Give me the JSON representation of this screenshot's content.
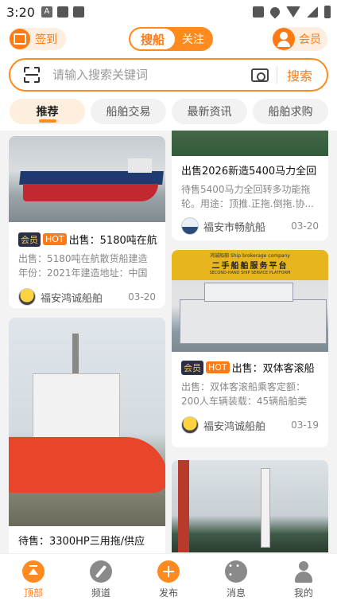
{
  "status_bar": {
    "time": "3:20",
    "a_icon": "A"
  },
  "header": {
    "checkin_label": "签到",
    "segment": {
      "active": "搜船",
      "inactive": "关注"
    },
    "member_label": "会员"
  },
  "search": {
    "placeholder": "请输入搜索关键词",
    "button": "搜索"
  },
  "tabs": [
    {
      "label": "推荐",
      "active": true
    },
    {
      "label": "船舶交易"
    },
    {
      "label": "最新资讯"
    },
    {
      "label": "船舶求购"
    }
  ],
  "cards": {
    "left1": {
      "vip_badge": "会员",
      "hot_badge": "HOT",
      "title": "出售：5180吨在航",
      "desc": "出售：5180吨在航散货船建造年份：2021年建造地址：中国 ...",
      "author": "福安鸿诚船舶",
      "date": "03-20"
    },
    "left2": {
      "title": "待售：3300HP三用拖/供应"
    },
    "right1": {
      "title": "出售2026新造5400马力全回",
      "desc": "待售5400马力全回转多功能拖轮。用途：顶推.正拖.倒拖.协...",
      "author": "福安市畅航船",
      "date": "03-20"
    },
    "right2": {
      "banner_small": "鸿诚船舶  Ship brokerage company",
      "banner_main": "二手船舶服务平台",
      "banner_sub": "SECOND-HAND SHIP SERVICE PLATFORM",
      "vip_badge": "会员",
      "hot_badge": "HOT",
      "title": "出售：双体客滚船",
      "desc": "出售：双体客滚船乘客定额：200人车辆装载：45辆船舶类型...",
      "author": "福安鸿诚船舶",
      "date": "03-19"
    }
  },
  "tabbar": [
    {
      "label": "顶部",
      "icon": "top-arrow-icon",
      "active": true
    },
    {
      "label": "频道",
      "icon": "compass-icon"
    },
    {
      "label": "发布",
      "icon": "plus-icon"
    },
    {
      "label": "消息",
      "icon": "message-icon"
    },
    {
      "label": "我的",
      "icon": "user-icon"
    }
  ],
  "colors": {
    "accent": "#ff8a1f",
    "background": "#f3f3f3"
  }
}
